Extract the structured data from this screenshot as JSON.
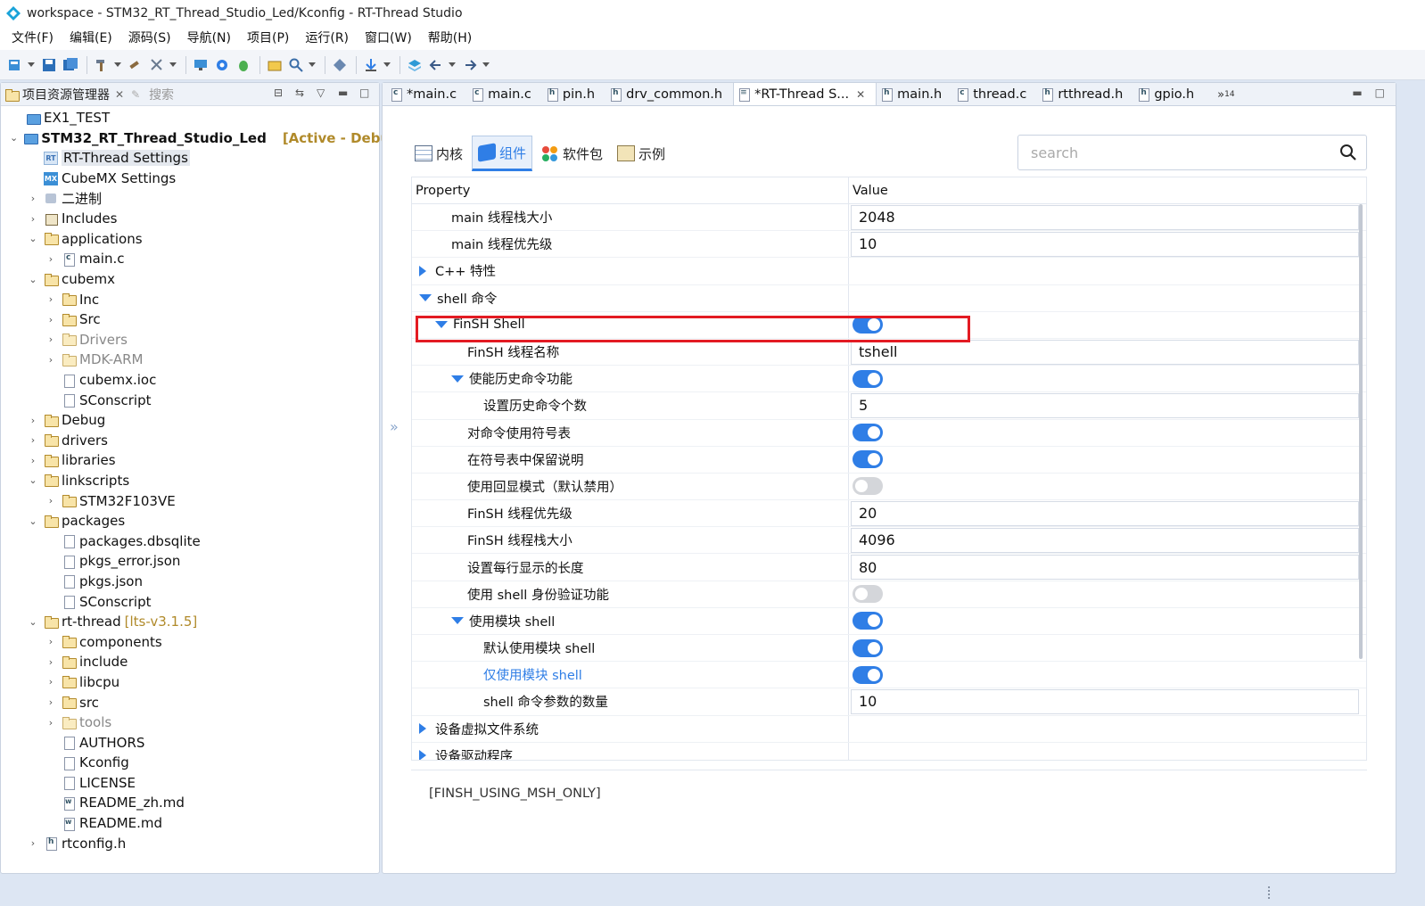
{
  "window": {
    "title": "workspace - STM32_RT_Thread_Studio_Led/Kconfig - RT-Thread Studio"
  },
  "menu": [
    "文件(F)",
    "编辑(E)",
    "源码(S)",
    "导航(N)",
    "项目(P)",
    "运行(R)",
    "窗口(W)",
    "帮助(H)"
  ],
  "left_panel": {
    "tab_active": "项目资源管理器",
    "tab_inactive": "搜索"
  },
  "tree": [
    {
      "label": "EX1_TEST",
      "depth": 0,
      "arrow": "",
      "icon": "project-icon"
    },
    {
      "label": "STM32_RT_Thread_Studio_Led",
      "depth": 0,
      "arrow": "open",
      "icon": "project-icon",
      "bold": true,
      "suffix": "[Active - Debug]"
    },
    {
      "label": "RT-Thread Settings",
      "depth": 1,
      "arrow": "",
      "icon": "rt-settings-icon",
      "selected": true
    },
    {
      "label": "CubeMX Settings",
      "depth": 1,
      "arrow": "",
      "icon": "cubemx-icon"
    },
    {
      "label": "二进制",
      "depth": 1,
      "arrow": "closed",
      "icon": "binaries-icon"
    },
    {
      "label": "Includes",
      "depth": 1,
      "arrow": "closed",
      "icon": "includes-icon"
    },
    {
      "label": "applications",
      "depth": 1,
      "arrow": "open",
      "icon": "folder-icon"
    },
    {
      "label": "main.c",
      "depth": 2,
      "arrow": "closed",
      "icon": "c-file-icon"
    },
    {
      "label": "cubemx",
      "depth": 1,
      "arrow": "open",
      "icon": "folder-icon"
    },
    {
      "label": "Inc",
      "depth": 2,
      "arrow": "closed",
      "icon": "folder-icon"
    },
    {
      "label": "Src",
      "depth": 2,
      "arrow": "closed",
      "icon": "folder-icon"
    },
    {
      "label": "Drivers",
      "depth": 2,
      "arrow": "closed",
      "icon": "excluded-folder-icon",
      "gray": true
    },
    {
      "label": "MDK-ARM",
      "depth": 2,
      "arrow": "closed",
      "icon": "excluded-folder-icon",
      "gray": true
    },
    {
      "label": "cubemx.ioc",
      "depth": 2,
      "arrow": "",
      "icon": "file-icon"
    },
    {
      "label": "SConscript",
      "depth": 2,
      "arrow": "",
      "icon": "file-icon"
    },
    {
      "label": "Debug",
      "depth": 1,
      "arrow": "closed",
      "icon": "folder-icon"
    },
    {
      "label": "drivers",
      "depth": 1,
      "arrow": "closed",
      "icon": "folder-icon"
    },
    {
      "label": "libraries",
      "depth": 1,
      "arrow": "closed",
      "icon": "folder-icon"
    },
    {
      "label": "linkscripts",
      "depth": 1,
      "arrow": "open",
      "icon": "folder-icon"
    },
    {
      "label": "STM32F103VE",
      "depth": 2,
      "arrow": "closed",
      "icon": "folder-icon"
    },
    {
      "label": "packages",
      "depth": 1,
      "arrow": "open",
      "icon": "folder-icon"
    },
    {
      "label": "packages.dbsqlite",
      "depth": 2,
      "arrow": "",
      "icon": "file-icon"
    },
    {
      "label": "pkgs_error.json",
      "depth": 2,
      "arrow": "",
      "icon": "file-icon"
    },
    {
      "label": "pkgs.json",
      "depth": 2,
      "arrow": "",
      "icon": "file-icon"
    },
    {
      "label": "SConscript",
      "depth": 2,
      "arrow": "",
      "icon": "file-icon"
    },
    {
      "label": "rt-thread",
      "depth": 1,
      "arrow": "open",
      "icon": "folder-icon",
      "suffix_thin": "[lts-v3.1.5]"
    },
    {
      "label": "components",
      "depth": 2,
      "arrow": "closed",
      "icon": "folder-icon"
    },
    {
      "label": "include",
      "depth": 2,
      "arrow": "closed",
      "icon": "folder-icon"
    },
    {
      "label": "libcpu",
      "depth": 2,
      "arrow": "closed",
      "icon": "folder-icon"
    },
    {
      "label": "src",
      "depth": 2,
      "arrow": "closed",
      "icon": "folder-icon"
    },
    {
      "label": "tools",
      "depth": 2,
      "arrow": "closed",
      "icon": "excluded-folder-icon",
      "gray": true
    },
    {
      "label": "AUTHORS",
      "depth": 2,
      "arrow": "",
      "icon": "file-icon"
    },
    {
      "label": "Kconfig",
      "depth": 2,
      "arrow": "",
      "icon": "file-icon"
    },
    {
      "label": "LICENSE",
      "depth": 2,
      "arrow": "",
      "icon": "file-icon"
    },
    {
      "label": "README_zh.md",
      "depth": 2,
      "arrow": "",
      "icon": "md-file-icon"
    },
    {
      "label": "README.md",
      "depth": 2,
      "arrow": "",
      "icon": "md-file-icon"
    },
    {
      "label": "rtconfig.h",
      "depth": 1,
      "arrow": "closed",
      "icon": "h-file-icon"
    }
  ],
  "editor_tabs": [
    {
      "label": "*main.c",
      "type": "c"
    },
    {
      "label": "main.c",
      "type": "c"
    },
    {
      "label": "pin.h",
      "type": "h"
    },
    {
      "label": "drv_common.h",
      "type": "h"
    },
    {
      "label": "*RT-Thread S...",
      "type": "k",
      "active": true
    },
    {
      "label": "main.h",
      "type": "h"
    },
    {
      "label": "thread.c",
      "type": "c"
    },
    {
      "label": "rtthread.h",
      "type": "h"
    },
    {
      "label": "gpio.h",
      "type": "h"
    }
  ],
  "editor_tabs_more": "»",
  "editor_tabs_more_count": "14",
  "inner_tabs": [
    {
      "label": "内核",
      "icon": "kernel-table-icon"
    },
    {
      "label": "组件",
      "icon": "component-cube-icon",
      "active": true
    },
    {
      "label": "软件包",
      "icon": "packages-flower-icon"
    },
    {
      "label": "示例",
      "icon": "examples-clipboard-icon"
    }
  ],
  "search": {
    "placeholder": "search",
    "value": ""
  },
  "table": {
    "col_property": "Property",
    "col_value": "Value",
    "rows": [
      {
        "label": "main 线程栈大小",
        "indent": 1,
        "tri": "",
        "kind": "input",
        "value": "2048"
      },
      {
        "label": "main 线程优先级",
        "indent": 1,
        "tri": "",
        "kind": "input",
        "value": "10"
      },
      {
        "label": "C++ 特性",
        "indent": 0,
        "tri": "right",
        "kind": "none",
        "value": ""
      },
      {
        "label": "shell 命令",
        "indent": 0,
        "tri": "down",
        "kind": "none",
        "value": ""
      },
      {
        "label": "FinSH Shell",
        "indent": 1,
        "tri": "down",
        "kind": "toggle",
        "on": true,
        "highlight": true
      },
      {
        "label": "FinSH 线程名称",
        "indent": 2,
        "tri": "",
        "kind": "input",
        "value": "tshell"
      },
      {
        "label": "使能历史命令功能",
        "indent": 2,
        "tri": "down",
        "kind": "toggle",
        "on": true
      },
      {
        "label": "设置历史命令个数",
        "indent": 3,
        "tri": "",
        "kind": "input",
        "value": "5"
      },
      {
        "label": "对命令使用符号表",
        "indent": 2,
        "tri": "",
        "kind": "toggle",
        "on": true
      },
      {
        "label": "在符号表中保留说明",
        "indent": 2,
        "tri": "",
        "kind": "toggle",
        "on": true
      },
      {
        "label": "使用回显模式（默认禁用）",
        "indent": 2,
        "tri": "",
        "kind": "toggle",
        "on": false
      },
      {
        "label": "FinSH 线程优先级",
        "indent": 2,
        "tri": "",
        "kind": "input",
        "value": "20"
      },
      {
        "label": "FinSH 线程栈大小",
        "indent": 2,
        "tri": "",
        "kind": "input",
        "value": "4096"
      },
      {
        "label": "设置每行显示的长度",
        "indent": 2,
        "tri": "",
        "kind": "input",
        "value": "80"
      },
      {
        "label": "使用 shell 身份验证功能",
        "indent": 2,
        "tri": "",
        "kind": "toggle",
        "on": false
      },
      {
        "label": "使用模块 shell",
        "indent": 2,
        "tri": "down",
        "kind": "toggle",
        "on": true
      },
      {
        "label": "默认使用模块 shell",
        "indent": 3,
        "tri": "",
        "kind": "toggle",
        "on": true
      },
      {
        "label": "仅使用模块 shell",
        "indent": 3,
        "tri": "",
        "kind": "toggle",
        "on": true,
        "link": true
      },
      {
        "label": "shell 命令参数的数量",
        "indent": 3,
        "tri": "",
        "kind": "input",
        "value": "10"
      },
      {
        "label": "设备虚拟文件系统",
        "indent": 0,
        "tri": "right",
        "kind": "none",
        "value": ""
      },
      {
        "label": "设备驱动程序",
        "indent": 0,
        "tri": "right",
        "kind": "none",
        "value": ""
      }
    ]
  },
  "description": "[FINSH_USING_MSH_ONLY]",
  "colors": {
    "accent": "#2f7ee6",
    "highlight": "#e31b23",
    "suffix": "#b08a2a"
  }
}
